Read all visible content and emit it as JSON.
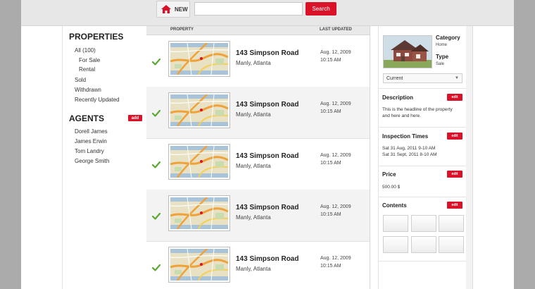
{
  "topbar": {
    "new_label": "NEW",
    "search_value": "",
    "search_placeholder": "",
    "search_label": "Search"
  },
  "left": {
    "properties_title": "PROPERTIES",
    "items": [
      {
        "label": "All (100)"
      },
      {
        "label": "For Sale"
      },
      {
        "label": "Rental"
      },
      {
        "label": "Sold"
      },
      {
        "label": "Withdrawn"
      },
      {
        "label": "Recently Updated"
      }
    ],
    "agents_title": "AGENTS",
    "agents_add_label": "add",
    "agents": [
      {
        "name": "Dorell James"
      },
      {
        "name": "James Erwin"
      },
      {
        "name": "Tom Landry"
      },
      {
        "name": "George Smith"
      }
    ]
  },
  "list": {
    "header_property": "PROPERTY",
    "header_updated": "LAST UPDATED",
    "rows": [
      {
        "address": "143 Simpson Road",
        "suburb": "Manly, Atlanta",
        "date": "Aug. 12, 2009",
        "time": "10:15 AM"
      },
      {
        "address": "143 Simpson Road",
        "suburb": "Manly, Atlanta",
        "date": "Aug. 12, 2009",
        "time": "10:15 AM"
      },
      {
        "address": "143 Simpson Road",
        "suburb": "Manly, Atlanta",
        "date": "Aug. 12, 2009",
        "time": "10:15 AM"
      },
      {
        "address": "143 Simpson Road",
        "suburb": "Manly, Atlanta",
        "date": "Aug. 12, 2009",
        "time": "10:15 AM"
      },
      {
        "address": "143 Simpson Road",
        "suburb": "Manly, Atlanta",
        "date": "Aug. 12, 2009",
        "time": "10:15 AM"
      }
    ]
  },
  "detail": {
    "category_label": "Category",
    "category_value": "Home",
    "type_label": "Type",
    "type_value": "Sale",
    "status_select": "Current",
    "edit_label": "edit",
    "description_title": "Description",
    "description_text_1": "This is the headline of the property",
    "description_text_2": "and here and here.",
    "inspection_title": "Inspection Times",
    "inspection_1": "Sat 31 Aug, 2011 9-10 AM",
    "inspection_2": "Sat 31 Sept, 2011 8-10 AM",
    "price_title": "Price",
    "price_value": "500.00 $",
    "contents_title": "Contents"
  },
  "colors": {
    "accent": "#d9122a",
    "check": "#5aa832",
    "page_bg": "#ababab"
  }
}
